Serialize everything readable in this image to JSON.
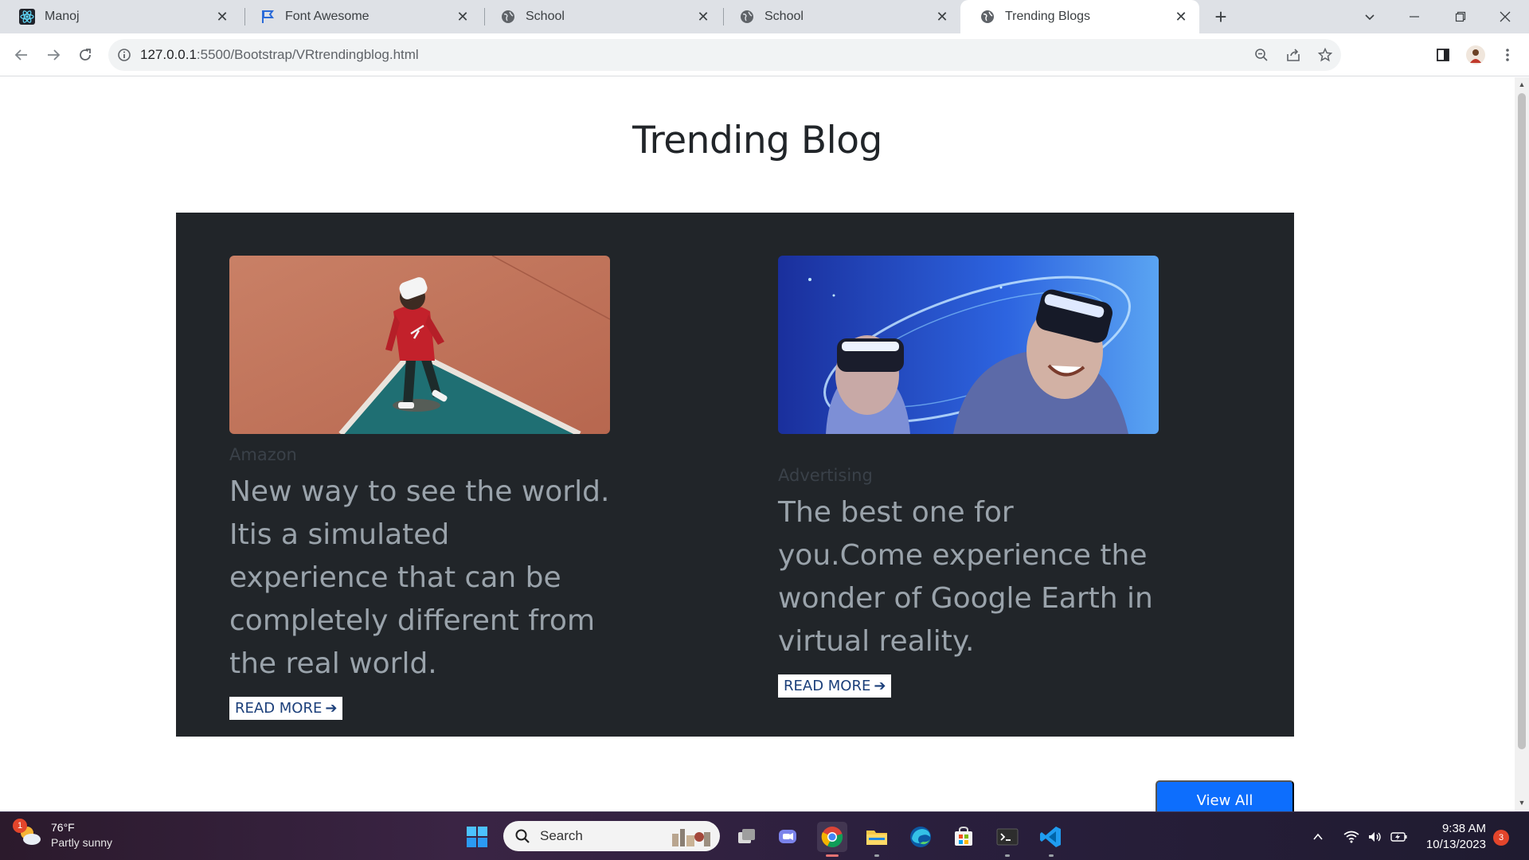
{
  "browser": {
    "tabs": [
      {
        "title": "Manoj",
        "icon": "react-icon"
      },
      {
        "title": "Font Awesome",
        "icon": "flag-icon"
      },
      {
        "title": "School",
        "icon": "globe-icon"
      },
      {
        "title": "School",
        "icon": "globe-icon"
      },
      {
        "title": "Trending Blogs",
        "icon": "globe-icon",
        "active": true
      }
    ],
    "url_host": "127.0.0.1",
    "url_path": ":5500/Bootstrap/VRtrendingblog.html"
  },
  "page": {
    "title": "Trending Blog",
    "cards": [
      {
        "category": "Amazon",
        "text": "New way to see the world. Itis a simulated experience that can be completely different from the real world.",
        "button": "READ MORE"
      },
      {
        "category": "Advertising",
        "text": "The best one for you.Come experience the wonder of Google Earth in virtual reality.",
        "button": "READ MORE"
      }
    ],
    "view_all": "View All"
  },
  "taskbar": {
    "weather_temp": "76°F",
    "weather_cond": "Partly sunny",
    "weather_badge": "1",
    "search_placeholder": "Search",
    "time": "9:38 AM",
    "date": "10/13/2023",
    "notif_count": "3"
  },
  "colors": {
    "panel": "#212529",
    "accent": "#0d6efd",
    "tabstrip": "#dee1e6"
  }
}
